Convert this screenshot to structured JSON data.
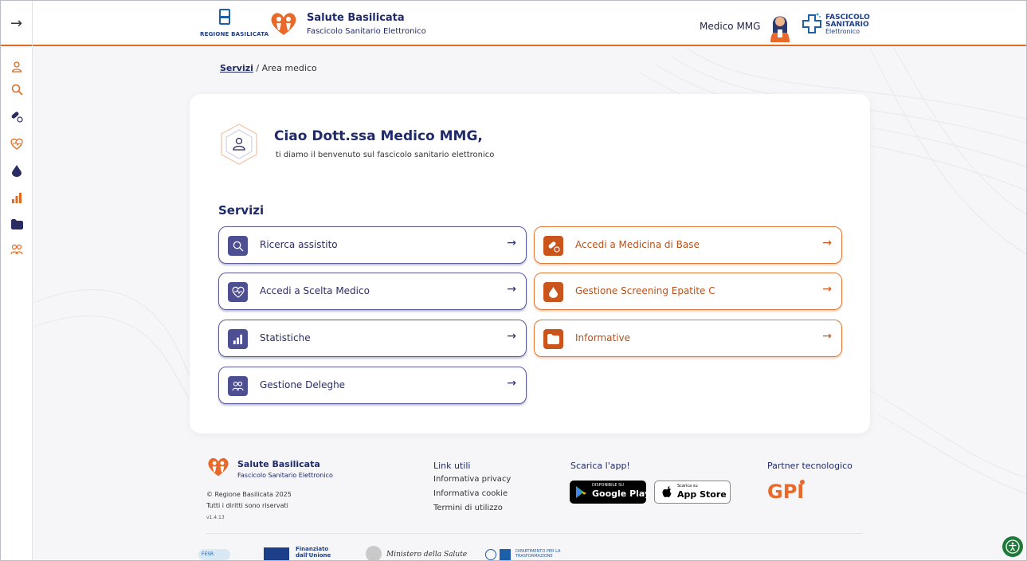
{
  "header": {
    "region_label": "REGIONE BASILICATA",
    "brand_title": "Salute Basilicata",
    "brand_subtitle": "Fascicolo Sanitario Elettronico",
    "user_role": "Medico MMG",
    "fse_logo": {
      "line1": "FASCICOLO",
      "line2": "SANITARIO",
      "line3": "Elettronico"
    },
    "collapse_icon": "arrow-right-icon"
  },
  "sidebar": {
    "items": [
      {
        "icon": "user-icon"
      },
      {
        "icon": "search-icon"
      },
      {
        "icon": "pill-icon"
      },
      {
        "icon": "heart-pulse-icon"
      },
      {
        "icon": "drop-icon"
      },
      {
        "icon": "bar-chart-icon"
      },
      {
        "icon": "folder-icon"
      },
      {
        "icon": "users-icon"
      }
    ]
  },
  "breadcrumb": {
    "root": "Servizi",
    "separator": " / ",
    "current": "Area medico"
  },
  "welcome": {
    "greeting": "Ciao Dott.ssa Medico MMG,",
    "message": "ti diamo il benvenuto sul fascicolo sanitario elettronico"
  },
  "services": {
    "title": "Servizi",
    "items": [
      {
        "label": "Ricerca assistito",
        "icon": "search-icon",
        "theme": "blue"
      },
      {
        "label": "Accedi a Medicina di Base",
        "icon": "pill-icon",
        "theme": "orange"
      },
      {
        "label": "Accedi a Scelta Medico",
        "icon": "heart-pulse-icon",
        "theme": "blue"
      },
      {
        "label": "Gestione Screening Epatite C",
        "icon": "drop-icon",
        "theme": "orange"
      },
      {
        "label": "Statistiche",
        "icon": "bar-chart-icon",
        "theme": "blue"
      },
      {
        "label": "Informative",
        "icon": "folder-icon",
        "theme": "orange"
      },
      {
        "label": "Gestione Deleghe",
        "icon": "users-icon",
        "theme": "blue"
      }
    ],
    "arrow": "→"
  },
  "footer": {
    "brand_title": "Salute Basilicata",
    "brand_subtitle": "Fascicolo Sanitario Elettronico",
    "copyright": "© Regione Basilicata 2025",
    "rights": "Tutti i diritti sono riservati",
    "version": "v1.4.13",
    "links_title": "Link utili",
    "links": [
      "Informativa privacy",
      "Informativa cookie",
      "Termini di utilizzo"
    ],
    "app_title": "Scarica l'app!",
    "google_play": {
      "small": "DISPONIBILE SU",
      "big": "Google Play"
    },
    "app_store": {
      "small": "Scarica su",
      "big": "App Store"
    },
    "partner_title": "Partner tecnologico",
    "partner_name": "GPI",
    "partners": [
      {
        "label": "FESR"
      },
      {
        "label": "Finanziato dall'Unione europea"
      },
      {
        "label": "Ministero della Salute"
      },
      {
        "label": "DIPARTIMENTO PER LA TRASFORMAZIONE"
      }
    ]
  },
  "colors": {
    "primary": "#1f2a6b",
    "blue_service": "#4e4f92",
    "orange_service": "#c9541c",
    "accent_line": "#e06a22"
  }
}
